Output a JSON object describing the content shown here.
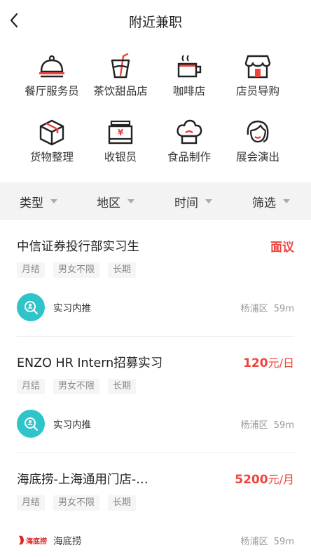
{
  "header": {
    "title": "附近兼职"
  },
  "categories": [
    {
      "label": "餐厅服务员",
      "icon": "cloche-icon"
    },
    {
      "label": "茶饮甜品店",
      "icon": "drink-cup-icon"
    },
    {
      "label": "咖啡店",
      "icon": "coffee-cup-icon"
    },
    {
      "label": "店员导购",
      "icon": "storefront-icon"
    },
    {
      "label": "货物整理",
      "icon": "box-icon"
    },
    {
      "label": "收银员",
      "icon": "cash-register-icon"
    },
    {
      "label": "食品制作",
      "icon": "chef-hat-icon"
    },
    {
      "label": "展会演出",
      "icon": "performer-icon"
    }
  ],
  "filters": [
    {
      "label": "类型"
    },
    {
      "label": "地区"
    },
    {
      "label": "时间"
    },
    {
      "label": "筛选"
    }
  ],
  "jobs": [
    {
      "title": "中信证券投行部实习生",
      "price": "面议",
      "unit": "",
      "tags": [
        "月结",
        "男女不限",
        "长期"
      ],
      "org": "实习内推",
      "district": "杨浦区",
      "distance": "59m"
    },
    {
      "title": "ENZO HR Intern招募实习",
      "price": "120",
      "unit": "元/日",
      "tags": [
        "月结",
        "男女不限",
        "长期"
      ],
      "org": "实习内推",
      "district": "杨浦区",
      "distance": "59m"
    },
    {
      "title": "海底捞-上海通用门店-…",
      "price": "5200",
      "unit": "元/月",
      "tags": [
        "月结",
        "男女不限",
        "长期"
      ],
      "org": "海底捞",
      "org_logo_text": "海底捞",
      "district": "杨浦区",
      "distance": "59m"
    }
  ],
  "colors": {
    "accent": "#f0433c",
    "avatar": "#2ec4c9",
    "filter_bg": "#f3f3f3",
    "tag_bg": "#f5f5f5"
  }
}
